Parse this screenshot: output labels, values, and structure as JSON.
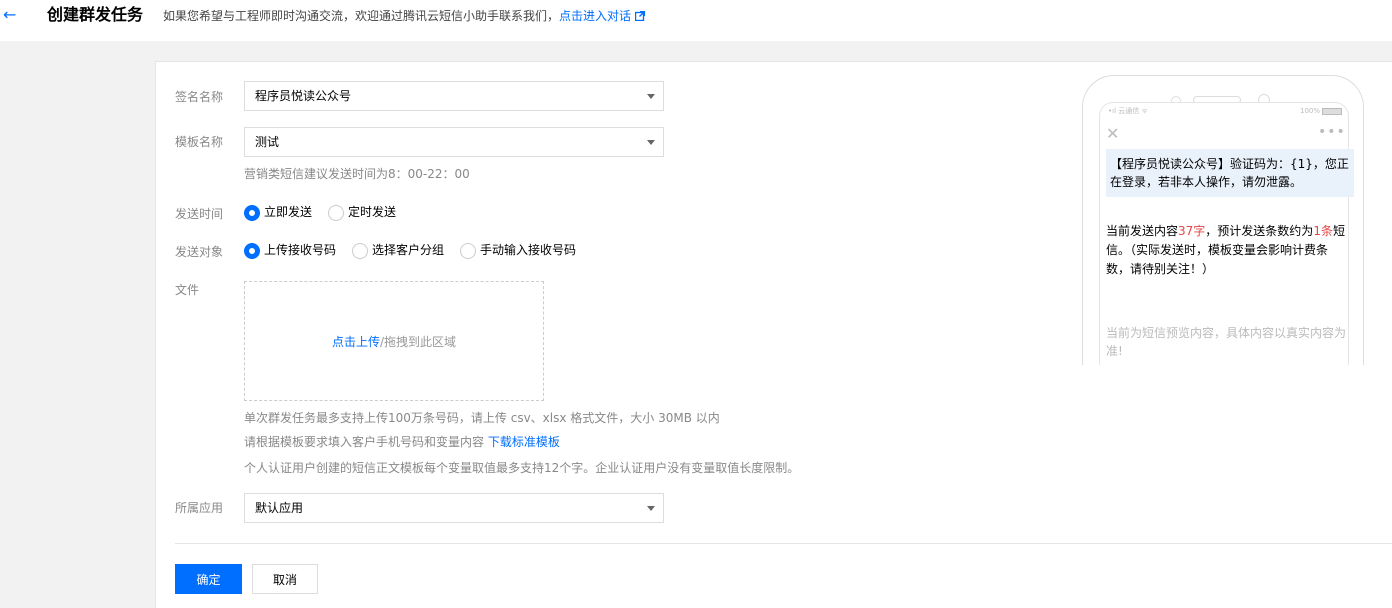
{
  "header": {
    "back_icon": "←",
    "title": "创建群发任务",
    "tip": "如果您希望与工程师即时沟通交流，欢迎通过腾讯云短信小助手联系我们，",
    "link": "点击进入对话",
    "link_icon": "external-link-icon"
  },
  "form": {
    "signature": {
      "label": "签名名称",
      "value": "程序员悦读公众号"
    },
    "template": {
      "label": "模板名称",
      "value": "测试",
      "hint": "营销类短信建议发送时间为8：00-22：00"
    },
    "send_time": {
      "label": "发送时间",
      "options": [
        {
          "label": "立即发送",
          "checked": true
        },
        {
          "label": "定时发送",
          "checked": false
        }
      ]
    },
    "target": {
      "label": "发送对象",
      "options": [
        {
          "label": "上传接收号码",
          "checked": true
        },
        {
          "label": "选择客户分组",
          "checked": false
        },
        {
          "label": "手动输入接收号码",
          "checked": false
        }
      ]
    },
    "file": {
      "label": "文件",
      "upload_link": "点击上传",
      "upload_rest": "/拖拽到此区域",
      "hint1": "单次群发任务最多支持上传100万条号码，请上传 csv、xlsx 格式文件，大小 30MB 以内",
      "hint2": "请根据模板要求填入客户手机号码和变量内容 ",
      "hint2_link": "下载标准模板",
      "hint3": "个人认证用户创建的短信正文模板每个变量取值最多支持12个字。企业认证用户没有变量取值长度限制。"
    },
    "app": {
      "label": "所属应用",
      "value": "默认应用"
    }
  },
  "buttons": {
    "confirm": "确定",
    "cancel": "取消"
  },
  "phone": {
    "carrier": "•ıl 云通信 ᯤ",
    "battery": "100%",
    "close_icon": "✕",
    "more_icon": "•••",
    "sms": "【程序员悦读公众号】验证码为：{1}，您正在登录，若非本人操作，请勿泄露。",
    "info_prefix": "当前发送内容",
    "info_chars": "37字",
    "info_mid": "，预计发送条数约为",
    "info_count": "1条",
    "info_suffix": "短信。（实际发送时，模板变量会影响计费条数，请待别关注！）",
    "preview_note": "当前为短信预览内容，具体内容以真实内容为准!"
  },
  "colors": {
    "accent": "#006eff",
    "highlight": "#e54545",
    "bubble": "#e9f1fb"
  }
}
